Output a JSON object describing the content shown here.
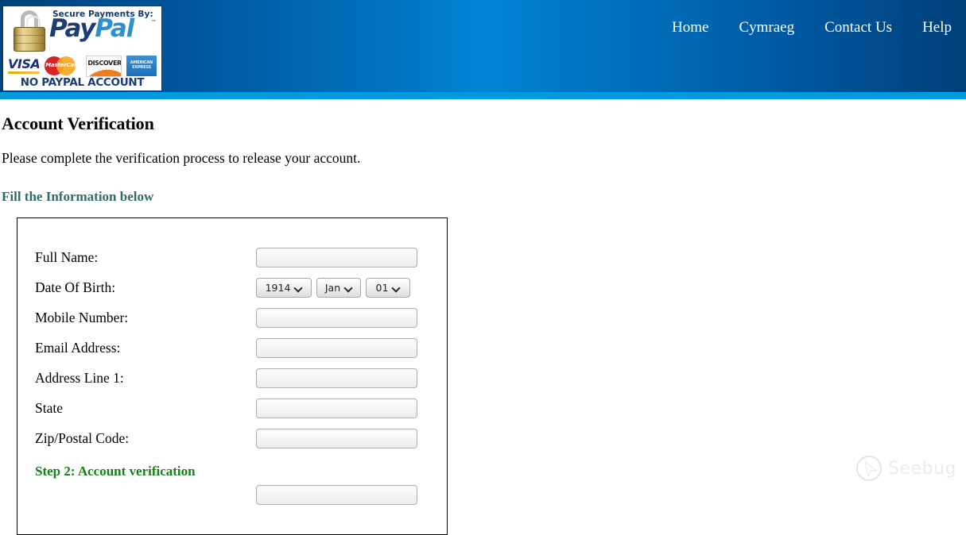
{
  "header": {
    "badge": {
      "secure_text": "Secure Payments By:",
      "brand_pay": "Pay",
      "brand_pal": "Pal",
      "trademark": "™",
      "cards": {
        "visa": "VISA",
        "mastercard": "MasterCard",
        "discover": "DISCOVER",
        "amex_line1": "AMERICAN",
        "amex_line2": "EXPRESS"
      },
      "footer_text": "NO PAYPAL ACCOUNT NEEDED!"
    },
    "nav": [
      {
        "label": "Home"
      },
      {
        "label": "Cymraeg"
      },
      {
        "label": "Contact Us"
      },
      {
        "label": "Help"
      }
    ],
    "colors": {
      "gradient_edge": "#00427c",
      "gradient_center": "#0086d6",
      "accent_strip": "#009ade"
    }
  },
  "main": {
    "title": "Account Verification",
    "subtitle": "Please complete the verification process to release your account.",
    "section_heading": "Fill the Information below",
    "section_heading_color": "#2f6b6b",
    "form": {
      "fields": [
        {
          "label": "Full Name:",
          "value": "",
          "placeholder": "",
          "type": "text"
        },
        {
          "label": "Mobile Number:",
          "value": "",
          "placeholder": "",
          "type": "text"
        },
        {
          "label": "Email Address:",
          "value": "",
          "placeholder": "",
          "type": "text"
        },
        {
          "label": "Address Line 1:",
          "value": "",
          "placeholder": "",
          "type": "text"
        },
        {
          "label": "State",
          "value": "",
          "placeholder": "",
          "type": "text"
        },
        {
          "label": "Zip/Postal Code:",
          "value": "",
          "placeholder": "",
          "type": "text"
        }
      ],
      "dob": {
        "label": "Date Of Birth:",
        "year": "1914",
        "month": "Jan",
        "day": "01"
      },
      "step2_heading": "Step 2: Account verification",
      "step2_heading_color": "#168016"
    }
  },
  "watermark": {
    "text": "Seebug"
  }
}
